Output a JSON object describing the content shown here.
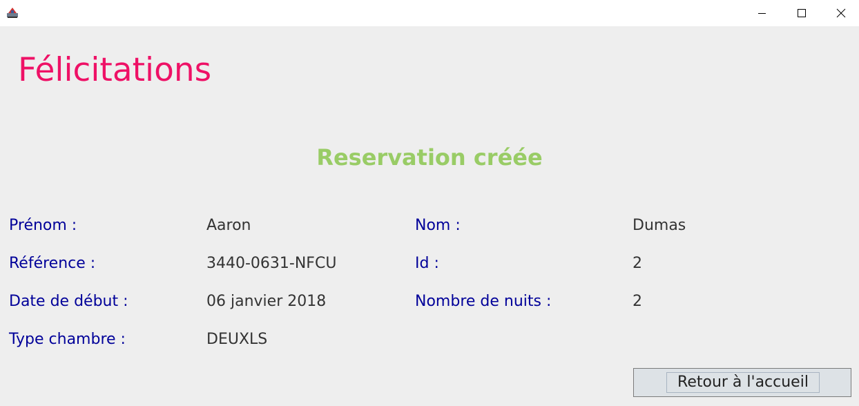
{
  "window": {
    "app_icon": "java-app-icon",
    "controls": {
      "minimize": "minimize-icon",
      "maximize": "maximize-icon",
      "close": "close-icon"
    }
  },
  "heading": "Félicitations",
  "subheading": "Reservation créée",
  "fields": {
    "prenom": {
      "label": "Prénom :",
      "value": "Aaron"
    },
    "nom": {
      "label": "Nom :",
      "value": "Dumas"
    },
    "reference": {
      "label": "Référence :",
      "value": "3440-0631-NFCU"
    },
    "id": {
      "label": "Id :",
      "value": "2"
    },
    "date_debut": {
      "label": "Date de début :",
      "value": "06 janvier 2018"
    },
    "nombre_nuits": {
      "label": "Nombre de nuits :",
      "value": "2"
    },
    "type_chambre": {
      "label": "Type chambre :",
      "value": "DEUXLS"
    }
  },
  "actions": {
    "home_label": "Retour à l'accueil"
  },
  "colors": {
    "heading": "#ee1166",
    "subheading": "#99cc66",
    "label": "#000099",
    "value": "#333333",
    "background": "#eeeeee"
  }
}
